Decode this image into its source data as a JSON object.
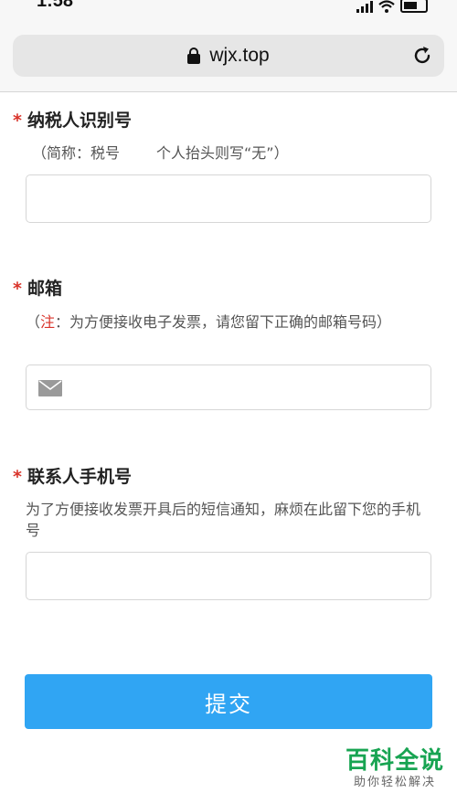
{
  "status": {
    "time": "1:58"
  },
  "browser": {
    "url": "wjx.top"
  },
  "form": {
    "taxpayer": {
      "label": "纳税人识别号",
      "required_mark": "*",
      "hint_left": "（简称：税号",
      "hint_right": "个人抬头则写“无”）",
      "value": ""
    },
    "email": {
      "label": "邮箱",
      "required_mark": "*",
      "hint_open": "（",
      "hint_note": "注",
      "hint_rest": "：为方便接收电子发票，请您留下正确的邮箱号码）",
      "value": ""
    },
    "phone": {
      "label": "联系人手机号",
      "required_mark": "*",
      "hint": "为了方便接收发票开具后的短信通知，麻烦在此留下您的手机号",
      "value": ""
    }
  },
  "submit_label": "提交",
  "watermark": {
    "title": "百科全说",
    "subtitle": "助你轻松解决"
  },
  "colors": {
    "required": "#d9342b",
    "button": "#30a5f3",
    "watermark": "#18a452"
  },
  "icons": [
    "signal-icon",
    "wifi-icon",
    "battery-icon",
    "lock-icon",
    "reload-icon",
    "mail-icon"
  ]
}
